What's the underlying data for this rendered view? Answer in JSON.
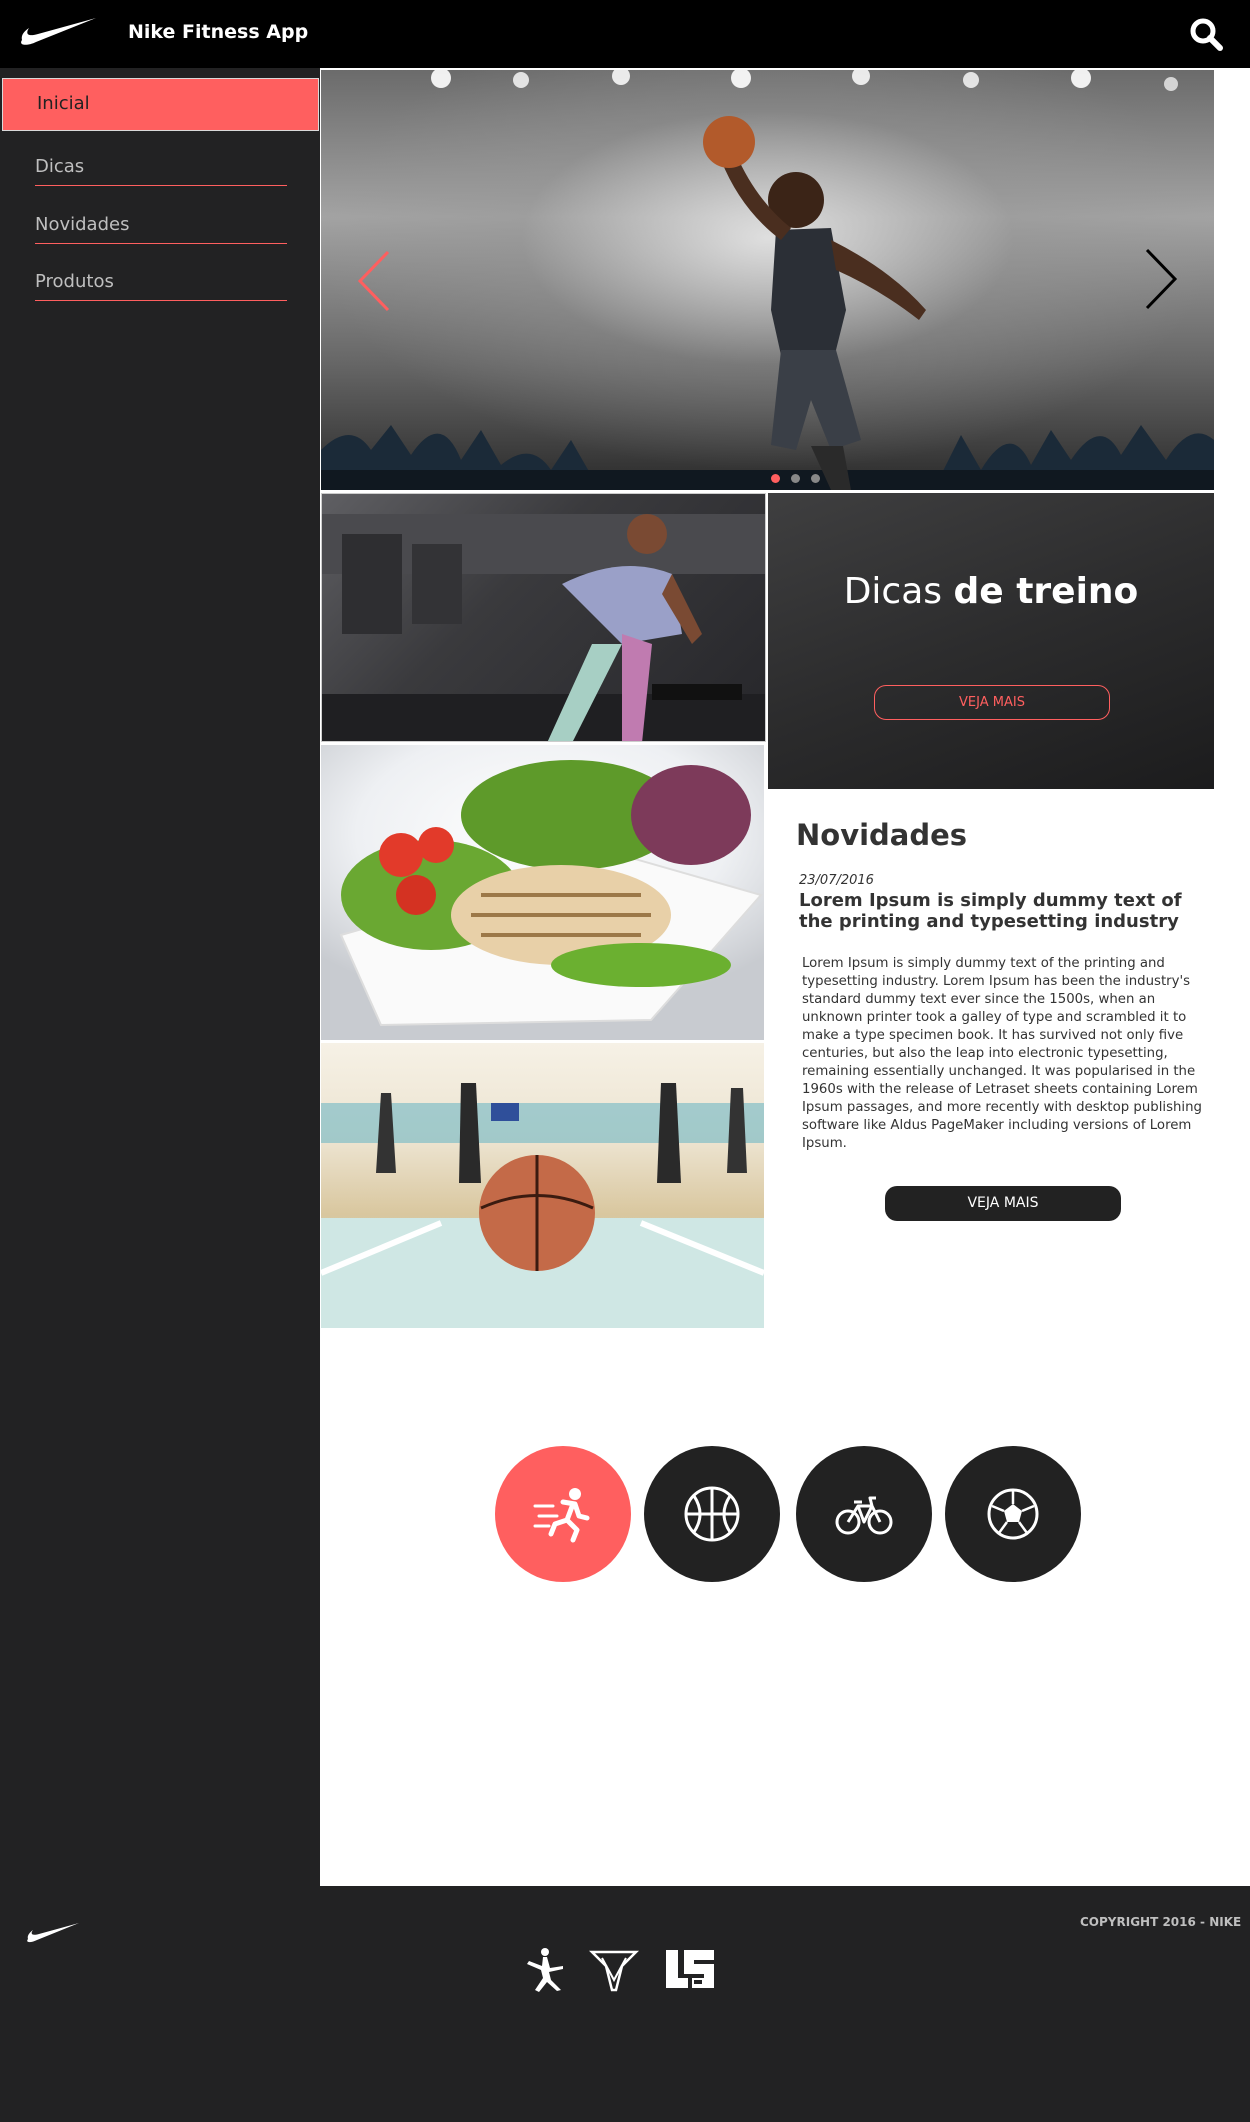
{
  "header": {
    "app_title": "Nike Fitness App",
    "logo_icon": "nike-swoosh-icon",
    "search_icon": "search-icon"
  },
  "sidebar": {
    "items": [
      {
        "label": "Inicial",
        "active": true
      },
      {
        "label": "Dicas",
        "active": false
      },
      {
        "label": "Novidades",
        "active": false
      },
      {
        "label": "Produtos",
        "active": false
      }
    ]
  },
  "carousel": {
    "slide_count": 3,
    "active_slide": 1,
    "prev_icon": "chevron-left-icon",
    "next_icon": "chevron-right-icon"
  },
  "tips": {
    "title_light": "Dicas",
    "title_bold": "de treino",
    "button": "VEJA MAIS"
  },
  "news": {
    "title": "Novidades",
    "date": "23/07/2016",
    "headline": "Lorem Ipsum is simply dummy text of the printing and typesetting industry",
    "body": "Lorem Ipsum is simply dummy text of the printing and typesetting industry. Lorem Ipsum has been the industry's standard dummy text ever since the 1500s, when an unknown printer took a galley of type and scrambled it to make a type specimen book. It has survived not only five centuries, but also the leap into electronic typesetting, remaining essentially unchanged. It was popularised in the 1960s with the release of Letraset sheets containing Lorem Ipsum passages, and more recently with desktop publishing software like Aldus PageMaker including versions of Lorem Ipsum.",
    "button": "VEJA MAIS"
  },
  "sports": [
    {
      "icon": "running-icon",
      "active": true
    },
    {
      "icon": "basketball-icon",
      "active": false
    },
    {
      "icon": "bicycle-icon",
      "active": false
    },
    {
      "icon": "soccer-ball-icon",
      "active": false
    }
  ],
  "footer": {
    "copyright": "COPYRIGHT 2016 - NIKE",
    "brands": [
      "jordan-logo-icon",
      "melo-logo-icon",
      "lebron-logo-icon"
    ]
  },
  "colors": {
    "accent": "#ff5f5f",
    "dark": "#222223",
    "header": "#000000"
  }
}
